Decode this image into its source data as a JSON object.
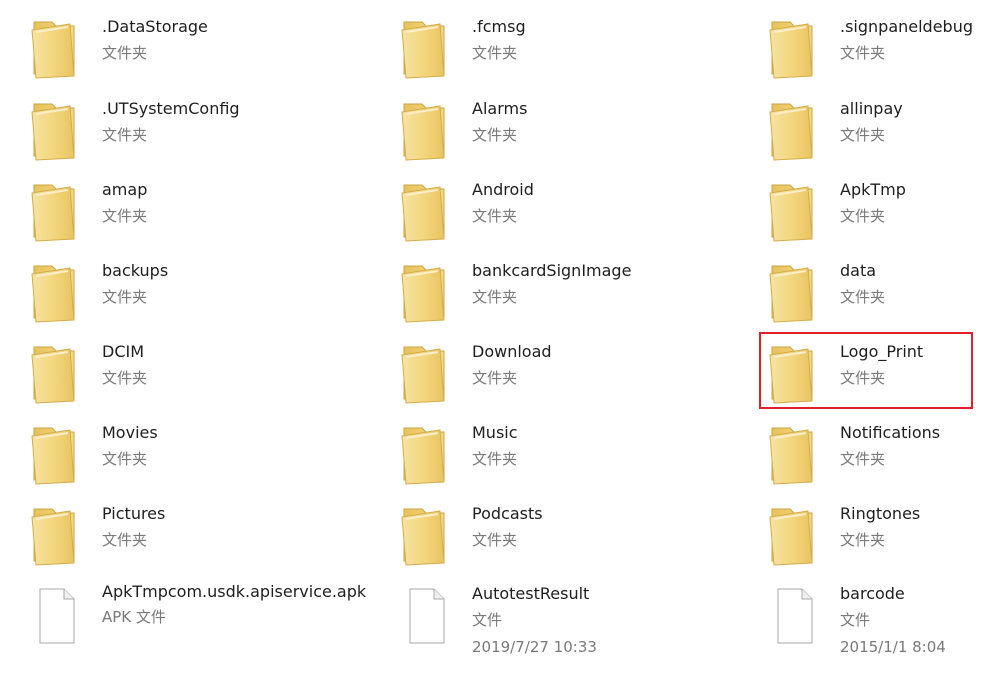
{
  "folder_type_label": "文件夹",
  "items": [
    {
      "name": ".DataStorage",
      "type": "文件夹",
      "kind": "folder"
    },
    {
      "name": ".fcmsg",
      "type": "文件夹",
      "kind": "folder"
    },
    {
      "name": ".signpaneldebug",
      "type": "文件夹",
      "kind": "folder"
    },
    {
      "name": ".UTSystemConfig",
      "type": "文件夹",
      "kind": "folder"
    },
    {
      "name": "Alarms",
      "type": "文件夹",
      "kind": "folder"
    },
    {
      "name": "allinpay",
      "type": "文件夹",
      "kind": "folder"
    },
    {
      "name": "amap",
      "type": "文件夹",
      "kind": "folder"
    },
    {
      "name": "Android",
      "type": "文件夹",
      "kind": "folder"
    },
    {
      "name": "ApkTmp",
      "type": "文件夹",
      "kind": "folder"
    },
    {
      "name": "backups",
      "type": "文件夹",
      "kind": "folder"
    },
    {
      "name": "bankcardSignImage",
      "type": "文件夹",
      "kind": "folder"
    },
    {
      "name": "data",
      "type": "文件夹",
      "kind": "folder"
    },
    {
      "name": "DCIM",
      "type": "文件夹",
      "kind": "folder"
    },
    {
      "name": "Download",
      "type": "文件夹",
      "kind": "folder"
    },
    {
      "name": "Logo_Print",
      "type": "文件夹",
      "kind": "folder",
      "highlighted": true
    },
    {
      "name": "Movies",
      "type": "文件夹",
      "kind": "folder"
    },
    {
      "name": "Music",
      "type": "文件夹",
      "kind": "folder"
    },
    {
      "name": "Notifications",
      "type": "文件夹",
      "kind": "folder"
    },
    {
      "name": "Pictures",
      "type": "文件夹",
      "kind": "folder"
    },
    {
      "name": "Podcasts",
      "type": "文件夹",
      "kind": "folder"
    },
    {
      "name": "Ringtones",
      "type": "文件夹",
      "kind": "folder"
    },
    {
      "name": "ApkTmpcom.usdk.apiservice.apk",
      "type": "APK 文件",
      "kind": "file"
    },
    {
      "name": "AutotestResult",
      "type": "文件",
      "date": "2019/7/27 10:33",
      "kind": "file"
    },
    {
      "name": "barcode",
      "type": "文件",
      "date": "2015/1/1 8:04",
      "kind": "file"
    }
  ],
  "colors": {
    "highlight_border": "#e0202a",
    "folder_yellow": "#f3d77e",
    "text": "#1e1e1e",
    "meta": "#7a7a7a"
  },
  "icons": {
    "folder": "folder-icon",
    "file": "file-icon"
  }
}
